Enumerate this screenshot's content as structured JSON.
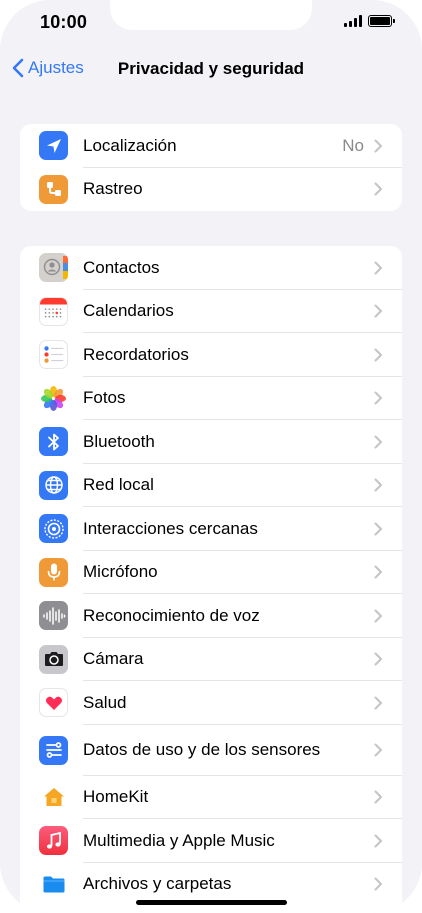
{
  "status": {
    "time": "10:00"
  },
  "nav": {
    "back_label": "Ajustes",
    "title": "Privacidad y seguridad"
  },
  "group1": [
    {
      "name": "localizacion",
      "label": "Localización",
      "value": "No",
      "icon": "location-arrow-icon",
      "color": "#3478f6"
    },
    {
      "name": "rastreo",
      "label": "Rastreo",
      "value": "",
      "icon": "tracking-icon",
      "color": "#f09a37"
    }
  ],
  "group2": [
    {
      "name": "contactos",
      "label": "Contactos",
      "icon": "contacts-icon"
    },
    {
      "name": "calendarios",
      "label": "Calendarios",
      "icon": "calendar-icon"
    },
    {
      "name": "recordatorios",
      "label": "Recordatorios",
      "icon": "reminders-icon"
    },
    {
      "name": "fotos",
      "label": "Fotos",
      "icon": "photos-icon"
    },
    {
      "name": "bluetooth",
      "label": "Bluetooth",
      "icon": "bluetooth-icon",
      "color": "#3478f6"
    },
    {
      "name": "red-local",
      "label": "Red local",
      "icon": "globe-icon",
      "color": "#3478f6"
    },
    {
      "name": "interacciones-cercanas",
      "label": "Interacciones cercanas",
      "icon": "nearby-interaction-icon",
      "color": "#3478f6"
    },
    {
      "name": "microfono",
      "label": "Micrófono",
      "icon": "microphone-icon",
      "color": "#f09a37"
    },
    {
      "name": "reconocimiento-de-voz",
      "label": "Reconocimiento de voz",
      "icon": "waveform-icon",
      "color": "#8e8e93"
    },
    {
      "name": "camara",
      "label": "Cámara",
      "icon": "camera-icon",
      "color": "#8e8e93"
    },
    {
      "name": "salud",
      "label": "Salud",
      "icon": "heart-icon",
      "color": "#ff2d55"
    },
    {
      "name": "datos-de-uso",
      "label": "Datos de uso y de los sensores",
      "icon": "sensor-data-icon",
      "color": "#3478f6"
    },
    {
      "name": "homekit",
      "label": "HomeKit",
      "icon": "home-icon",
      "color": "#f09a37"
    },
    {
      "name": "multimedia",
      "label": "Multimedia y Apple Music",
      "icon": "music-note-icon",
      "color": "#fa3c55"
    },
    {
      "name": "archivos",
      "label": "Archivos y carpetas",
      "icon": "folder-icon",
      "color": "#1a8cf0"
    }
  ]
}
